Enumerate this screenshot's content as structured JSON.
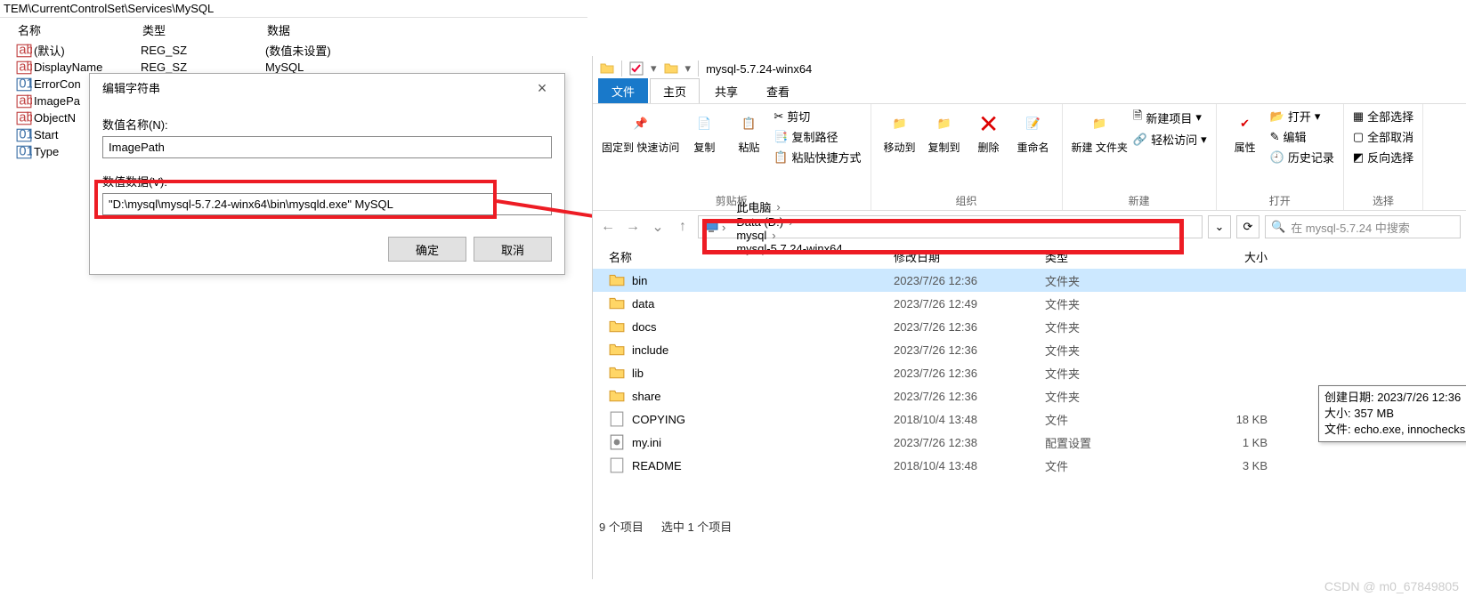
{
  "registry": {
    "path": "TEM\\CurrentControlSet\\Services\\MySQL",
    "headers": {
      "name": "名称",
      "type": "类型",
      "data": "数据"
    },
    "rows": [
      {
        "icon": "str",
        "name": "(默认)",
        "type": "REG_SZ",
        "data": "(数值未设置)"
      },
      {
        "icon": "str",
        "name": "DisplayName",
        "type": "REG_SZ",
        "data": "MySQL"
      },
      {
        "icon": "bin",
        "name": "ErrorCon",
        "type": "",
        "data": ""
      },
      {
        "icon": "str",
        "name": "ImagePa",
        "type": "",
        "data": ""
      },
      {
        "icon": "str",
        "name": "ObjectN",
        "type": "",
        "data": ""
      },
      {
        "icon": "bin",
        "name": "Start",
        "type": "",
        "data": ""
      },
      {
        "icon": "bin",
        "name": "Type",
        "type": "",
        "data": ""
      }
    ]
  },
  "dialog": {
    "title": "编辑字符串",
    "name_label": "数值名称(N):",
    "name_value": "ImagePath",
    "data_label": "数值数据(V):",
    "data_value": "\"D:\\mysql\\mysql-5.7.24-winx64\\bin\\mysqld.exe\" MySQL",
    "ok": "确定",
    "cancel": "取消"
  },
  "explorer": {
    "title": "mysql-5.7.24-winx64",
    "tabs": {
      "file": "文件",
      "home": "主页",
      "share": "共享",
      "view": "查看"
    },
    "ribbon": {
      "clipboard": {
        "pin": "固定到\n快速访问",
        "copy": "复制",
        "paste": "粘贴",
        "cut": "剪切",
        "copypath": "复制路径",
        "pasteshort": "粘贴快捷方式",
        "group": "剪贴板"
      },
      "organize": {
        "moveto": "移动到",
        "copyto": "复制到",
        "delete": "删除",
        "rename": "重命名",
        "group": "组织"
      },
      "new": {
        "newfolder": "新建\n文件夹",
        "newitem": "新建项目",
        "easyaccess": "轻松访问",
        "group": "新建"
      },
      "open": {
        "properties": "属性",
        "open": "打开",
        "edit": "编辑",
        "history": "历史记录",
        "group": "打开"
      },
      "select": {
        "all": "全部选择",
        "none": "全部取消",
        "invert": "反向选择",
        "group": "选择"
      }
    },
    "breadcrumbs": [
      "此电脑",
      "Data (D:)",
      "mysql",
      "mysql-5.7.24-winx64"
    ],
    "search_placeholder": "在 mysql-5.7.24 中搜索",
    "columns": {
      "name": "名称",
      "date": "修改日期",
      "type": "类型",
      "size": "大小"
    },
    "files": [
      {
        "icon": "folder",
        "name": "bin",
        "date": "2023/7/26 12:36",
        "type": "文件夹",
        "size": "",
        "selected": true
      },
      {
        "icon": "folder",
        "name": "data",
        "date": "2023/7/26 12:49",
        "type": "文件夹",
        "size": ""
      },
      {
        "icon": "folder",
        "name": "docs",
        "date": "2023/7/26 12:36",
        "type": "文件夹",
        "size": ""
      },
      {
        "icon": "folder",
        "name": "include",
        "date": "2023/7/26 12:36",
        "type": "文件夹",
        "size": ""
      },
      {
        "icon": "folder",
        "name": "lib",
        "date": "2023/7/26 12:36",
        "type": "文件夹",
        "size": ""
      },
      {
        "icon": "folder",
        "name": "share",
        "date": "2023/7/26 12:36",
        "type": "文件夹",
        "size": ""
      },
      {
        "icon": "file",
        "name": "COPYING",
        "date": "2018/10/4 13:48",
        "type": "文件",
        "size": "18 KB"
      },
      {
        "icon": "ini",
        "name": "my.ini",
        "date": "2023/7/26 12:38",
        "type": "配置设置",
        "size": "1 KB"
      },
      {
        "icon": "file",
        "name": "README",
        "date": "2018/10/4 13:48",
        "type": "文件",
        "size": "3 KB"
      }
    ],
    "tooltip": {
      "l1": "创建日期: 2023/7/26 12:36",
      "l2": "大小: 357 MB",
      "l3": "文件: echo.exe, innochecksum.exe, libmecab.dll, ..."
    },
    "status": {
      "count": "9 个项目",
      "selected": "选中 1 个项目"
    }
  },
  "watermark": "CSDN @ m0_67849805"
}
